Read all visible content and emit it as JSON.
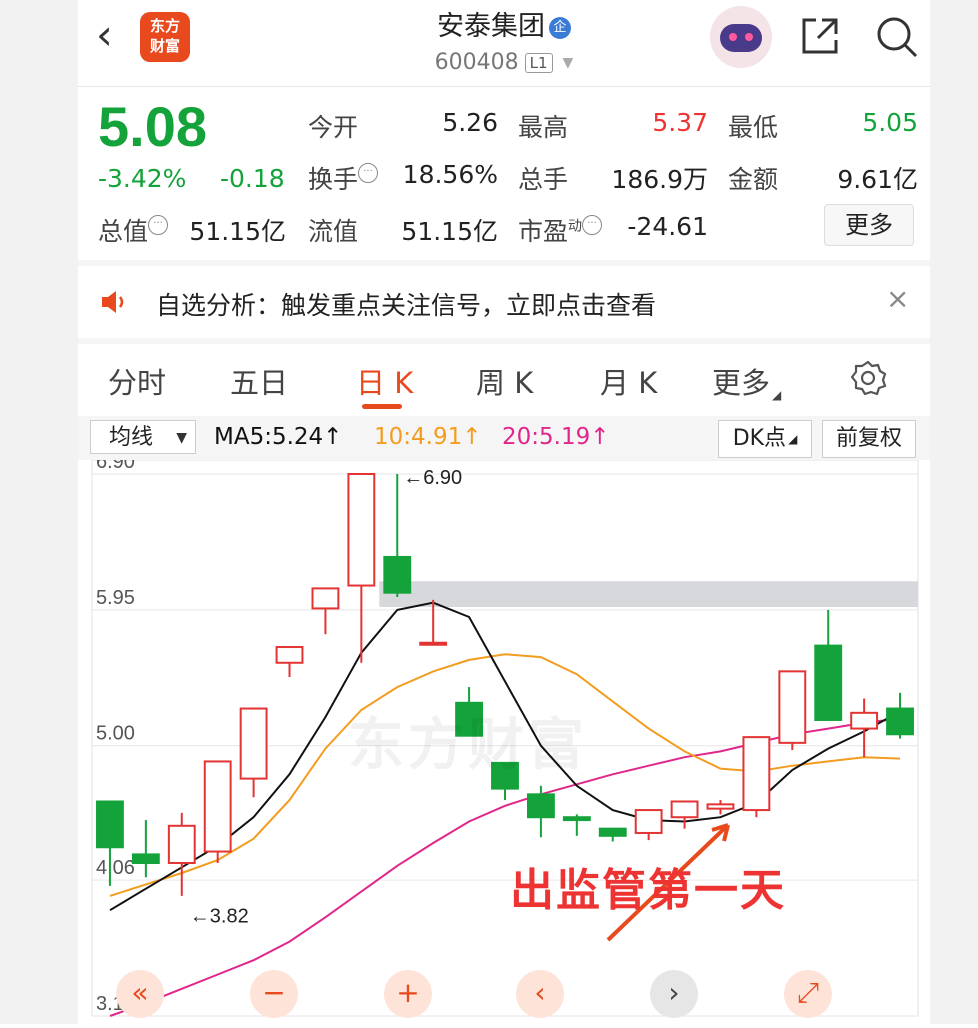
{
  "header": {
    "back_icon": "chevron-left-icon",
    "logo_line1": "东方",
    "logo_line2": "财富",
    "stock_name": "安泰集团",
    "badge": "企",
    "stock_code": "600408",
    "level_badge": "L1"
  },
  "quote": {
    "price": "5.08",
    "change_pct": "-3.42%",
    "change_amt": "-0.18",
    "fields": {
      "open_label": "今开",
      "open": "5.26",
      "high_label": "最高",
      "high": "5.37",
      "low_label": "最低",
      "low": "5.05",
      "turnover_label": "换手",
      "turnover": "18.56%",
      "volume_label": "总手",
      "volume": "186.9万",
      "amount_label": "金额",
      "amount": "9.61亿",
      "mktcap_label": "总值",
      "mktcap": "51.15亿",
      "float_label": "流值",
      "float": "51.15亿",
      "pe_label": "市盈",
      "pe_sup": "动",
      "pe": "-24.61"
    },
    "more_button": "更多"
  },
  "alert": {
    "text": "自选分析：触发重点关注信号，立即点击查看",
    "close": "×"
  },
  "tabs": [
    {
      "label": "分时",
      "active": false
    },
    {
      "label": "五日",
      "active": false
    },
    {
      "label": "日 K",
      "active": true
    },
    {
      "label": "周 K",
      "active": false
    },
    {
      "label": "月 K",
      "active": false
    },
    {
      "label": "更多",
      "active": false
    }
  ],
  "indicators": {
    "ma_select": "均线",
    "ma5": "MA5:5.24↑",
    "ma10": "10:4.91↑",
    "ma20": "20:5.19↑",
    "dk_button": "DK点",
    "adjust_button": "前复权"
  },
  "colors": {
    "up": "#e33333",
    "down": "#14a33a",
    "ma5": "#111111",
    "ma10": "#f39c1f",
    "ma20": "#e0268a",
    "accent": "#e8491d"
  },
  "chart_data": {
    "type": "candlestick",
    "y_ticks": [
      "6.90",
      "5.95",
      "5.00",
      "4.06",
      "3.11"
    ],
    "ylim": [
      3.11,
      6.9
    ],
    "max_marker": "←6.90",
    "min_marker": "←3.82",
    "watermark": "东方财富",
    "annotation": "出监管第一天",
    "candles": [
      {
        "o": 4.61,
        "c": 4.29,
        "h": 4.61,
        "l": 4.02
      },
      {
        "o": 4.24,
        "c": 4.18,
        "h": 4.48,
        "l": 4.08
      },
      {
        "o": 4.18,
        "c": 4.44,
        "h": 4.53,
        "l": 3.95
      },
      {
        "o": 4.26,
        "c": 4.89,
        "h": 4.89,
        "l": 4.18
      },
      {
        "o": 4.77,
        "c": 5.26,
        "h": 5.26,
        "l": 4.64
      },
      {
        "o": 5.58,
        "c": 5.69,
        "h": 5.69,
        "l": 5.48
      },
      {
        "o": 5.96,
        "c": 6.1,
        "h": 6.1,
        "l": 5.78
      },
      {
        "o": 6.12,
        "c": 6.9,
        "h": 6.9,
        "l": 5.58
      },
      {
        "o": 6.32,
        "c": 6.07,
        "h": 6.9,
        "l": 6.04
      },
      {
        "o": 5.72,
        "c": 5.72,
        "h": 6.02,
        "l": 5.72
      },
      {
        "o": 5.3,
        "c": 5.07,
        "h": 5.41,
        "l": 5.07
      },
      {
        "o": 4.88,
        "c": 4.7,
        "h": 4.88,
        "l": 4.62
      },
      {
        "o": 4.66,
        "c": 4.5,
        "h": 4.72,
        "l": 4.36
      },
      {
        "o": 4.5,
        "c": 4.48,
        "h": 4.52,
        "l": 4.37
      },
      {
        "o": 4.42,
        "c": 4.37,
        "h": 4.42,
        "l": 4.33
      },
      {
        "o": 4.39,
        "c": 4.55,
        "h": 4.55,
        "l": 4.34
      },
      {
        "o": 4.5,
        "c": 4.61,
        "h": 4.61,
        "l": 4.42
      },
      {
        "o": 4.56,
        "c": 4.59,
        "h": 4.62,
        "l": 4.52
      },
      {
        "o": 4.55,
        "c": 5.06,
        "h": 5.06,
        "l": 4.5
      },
      {
        "o": 5.02,
        "c": 5.52,
        "h": 5.52,
        "l": 4.97
      },
      {
        "o": 5.7,
        "c": 5.18,
        "h": 5.95,
        "l": 5.18
      },
      {
        "o": 5.12,
        "c": 5.23,
        "h": 5.33,
        "l": 4.92
      },
      {
        "o": 5.26,
        "c": 5.08,
        "h": 5.37,
        "l": 5.05
      }
    ],
    "ma5": [
      3.85,
      4.0,
      4.15,
      4.3,
      4.5,
      4.8,
      5.2,
      5.65,
      5.95,
      6.0,
      5.9,
      5.45,
      5.0,
      4.72,
      4.55,
      4.48,
      4.47,
      4.5,
      4.6,
      4.83,
      4.98,
      5.1,
      5.24
    ],
    "ma10": [
      3.95,
      4.03,
      4.11,
      4.2,
      4.35,
      4.62,
      4.98,
      5.25,
      5.41,
      5.52,
      5.6,
      5.64,
      5.62,
      5.5,
      5.31,
      5.12,
      4.96,
      4.84,
      4.82,
      4.86,
      4.89,
      4.92,
      4.91
    ],
    "ma20": [
      3.11,
      3.2,
      3.3,
      3.4,
      3.5,
      3.63,
      3.8,
      3.98,
      4.16,
      4.32,
      4.47,
      4.58,
      4.66,
      4.73,
      4.8,
      4.86,
      4.92,
      4.96,
      5.02,
      5.08,
      5.12,
      5.16,
      5.19
    ],
    "gray_band": [
      5.97,
      6.15
    ]
  }
}
